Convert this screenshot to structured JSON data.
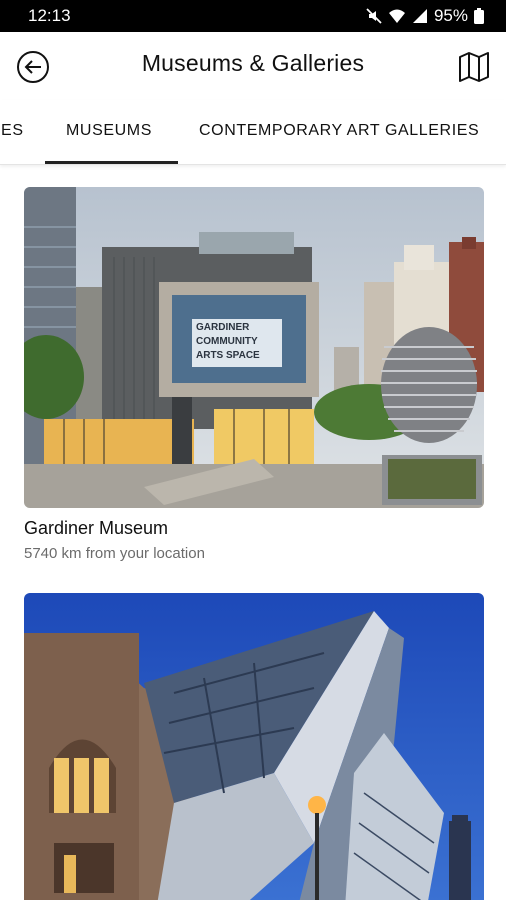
{
  "status_bar": {
    "time": "12:13",
    "battery": "95%"
  },
  "app_bar": {
    "title": "Museums & Galleries",
    "back_icon": "back-arrow-icon",
    "map_icon": "map-icon"
  },
  "tabs": [
    {
      "label": "IES",
      "selected": false
    },
    {
      "label": "MUSEUMS",
      "selected": true
    },
    {
      "label": "CONTEMPORARY ART GALLERIES",
      "selected": false
    }
  ],
  "places": [
    {
      "name": "Gardiner Museum",
      "distance": "5740 km from your location",
      "sign_lines": [
        "GARDINER",
        "COMMUNITY",
        "ARTS SPACE"
      ]
    },
    {
      "name": "",
      "distance": ""
    }
  ],
  "colors": {
    "accent": "#222222",
    "secondary_text": "#6b6b6b"
  }
}
